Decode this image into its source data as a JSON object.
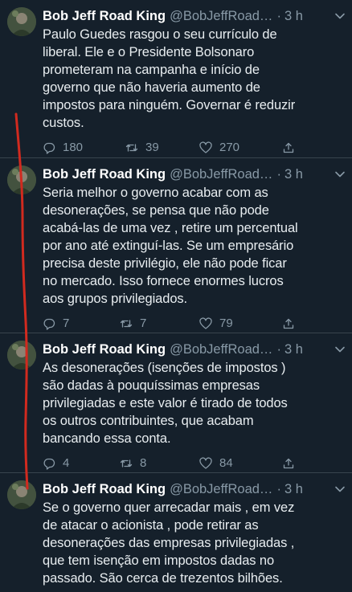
{
  "tweets": [
    {
      "name": "Bob Jeff Road King",
      "handle": "@BobJeffRoad…",
      "dot": "·",
      "time": "3 h",
      "lines": [
        "Paulo Guedes rasgou o seu currículo de",
        "liberal. Ele e o Presidente Bolsonaro",
        "prometeram na campanha e início de",
        "governo que não haveria aumento de",
        "impostos para ninguém. Governar é reduzir",
        "custos."
      ],
      "replies": "180",
      "retweets": "39",
      "likes": "270"
    },
    {
      "name": "Bob Jeff Road King",
      "handle": "@BobJeffRoad…",
      "dot": "·",
      "time": "3 h",
      "lines": [
        "Seria melhor o governo acabar com as",
        "desonerações, se pensa que não pode",
        "acabá-las de uma vez , retire um percentual",
        "por ano até extinguí-las. Se um empresário",
        "precisa deste privilégio, ele não pode ficar",
        "no mercado. Isso fornece enormes lucros",
        "aos grupos privilegiados."
      ],
      "replies": "7",
      "retweets": "7",
      "likes": "79"
    },
    {
      "name": "Bob Jeff Road King",
      "handle": "@BobJeffRoad…",
      "dot": "·",
      "time": "3 h",
      "lines": [
        "As desonerações (isenções de impostos )",
        "são dadas à pouquíssimas empresas",
        "privilegiadas e este valor é tirado de todos",
        "os outros contribuintes, que acabam",
        "bancando essa conta."
      ],
      "replies": "4",
      "retweets": "8",
      "likes": "84"
    },
    {
      "name": "Bob Jeff Road King",
      "handle": "@BobJeffRoad…",
      "dot": "·",
      "time": "3 h",
      "lines": [
        "Se o governo quer arrecadar mais , em vez",
        "de atacar o acionista , pode retirar as",
        "desonerações das empresas privilegiadas ,",
        "que tem isenção em impostos dadas no",
        "passado. São cerca de trezentos bilhões."
      ]
    }
  ],
  "icons": {
    "reply": "reply-icon",
    "retweet": "retweet-icon",
    "like": "heart-icon",
    "share": "share-icon",
    "menu": "chevron-down-icon"
  },
  "colors": {
    "background": "#15202b",
    "divider": "#38444d",
    "secondary_text": "#8899a6",
    "annotation": "#d12a1f"
  }
}
